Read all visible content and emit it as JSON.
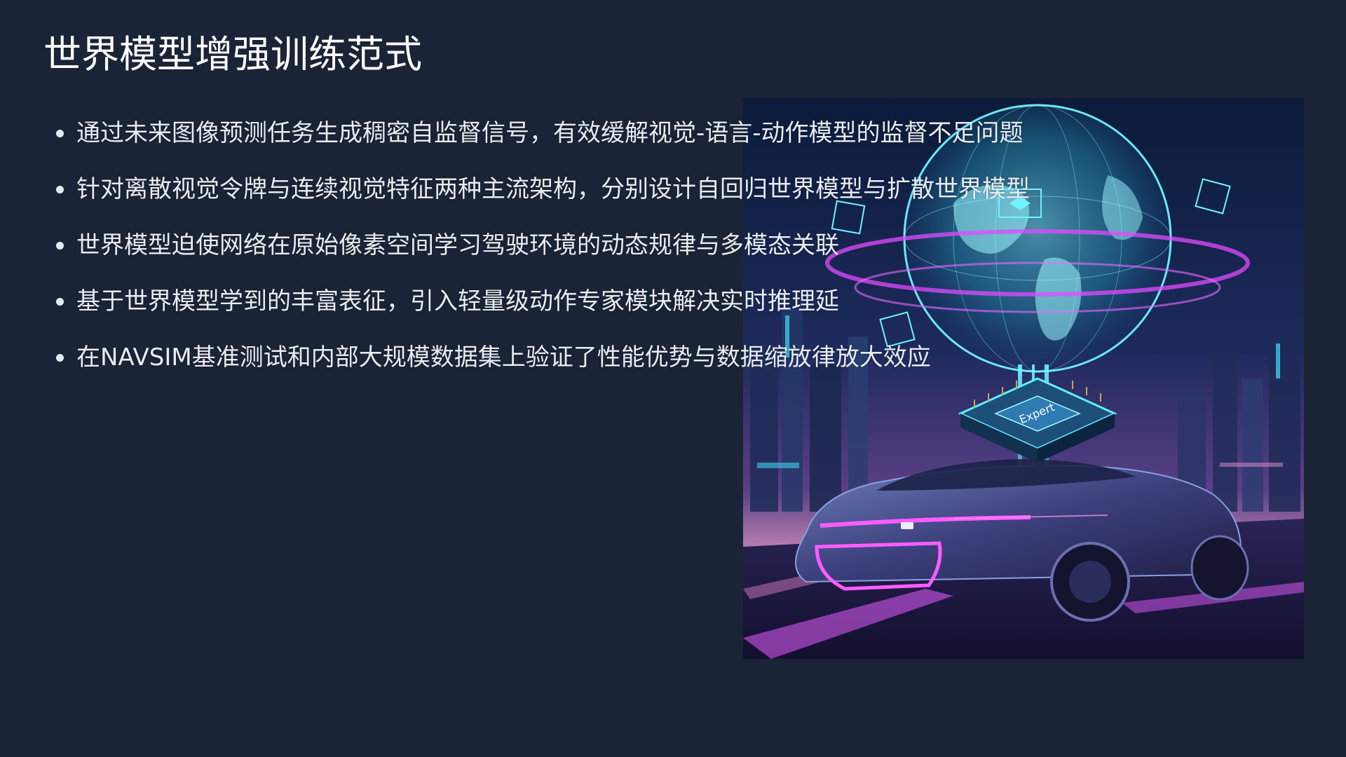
{
  "slide": {
    "title": "世界模型增强训练范式",
    "bullets": [
      "通过未来图像预测任务生成稠密自监督信号，有效缓解视觉-语言-动作模型的监督不足问题",
      "针对离散视觉令牌与连续视觉特征两种主流架构，分别设计自回归世界模型与扩散世界模型",
      "世界模型迫使网络在原始像素空间学习驾驶环境的动态规律与多模态关联",
      "基于世界模型学到的丰富表征，引入轻量级动作专家模块解决实时推理延",
      "在NAVSIM基准测试和内部大规模数据集上验证了性能优势与数据缩放律放大效应"
    ]
  },
  "illustration": {
    "chip_label": "Expert",
    "elements": [
      "holographic-globe",
      "ai-chip",
      "futuristic-car",
      "city-skyline"
    ]
  },
  "colors": {
    "background": "#1b2436",
    "title": "#ffffff",
    "bullet_text": "#e9ecf2",
    "glow_cyan": "#4ff3ff",
    "glow_magenta": "#e24bff"
  }
}
